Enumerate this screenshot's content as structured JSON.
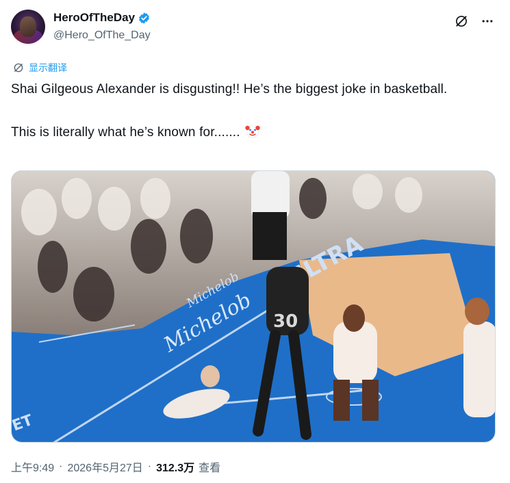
{
  "author": {
    "display_name": "HeroOfTheDay",
    "handle": "@Hero_OfThe_Day",
    "verified": true
  },
  "actions": {
    "grok_icon": "grok-slash-icon",
    "more_icon": "more-horizontal-icon"
  },
  "translate": {
    "label": "显示翻译",
    "icon": "translate-icon"
  },
  "tweet": {
    "line1": "Shai Gilgeous Alexander is disgusting!! He’s the biggest joke in basketball.",
    "line2": "This is literally what he’s known for.......",
    "emoji": "clown-face-emoji"
  },
  "media": {
    "court_text_1": "ULTRA",
    "court_text_2": "Michelob",
    "court_text_3": "Michelob",
    "jersey_number": "30"
  },
  "meta": {
    "time": "上午9:49",
    "separator": "·",
    "date": "2026年5月27日",
    "views_count": "312.3万",
    "views_label": "查看"
  },
  "colors": {
    "accent": "#1d9bf0",
    "secondary_text": "#536471",
    "court_blue": "#1f6fc8",
    "court_wood": "#e9b98a"
  }
}
